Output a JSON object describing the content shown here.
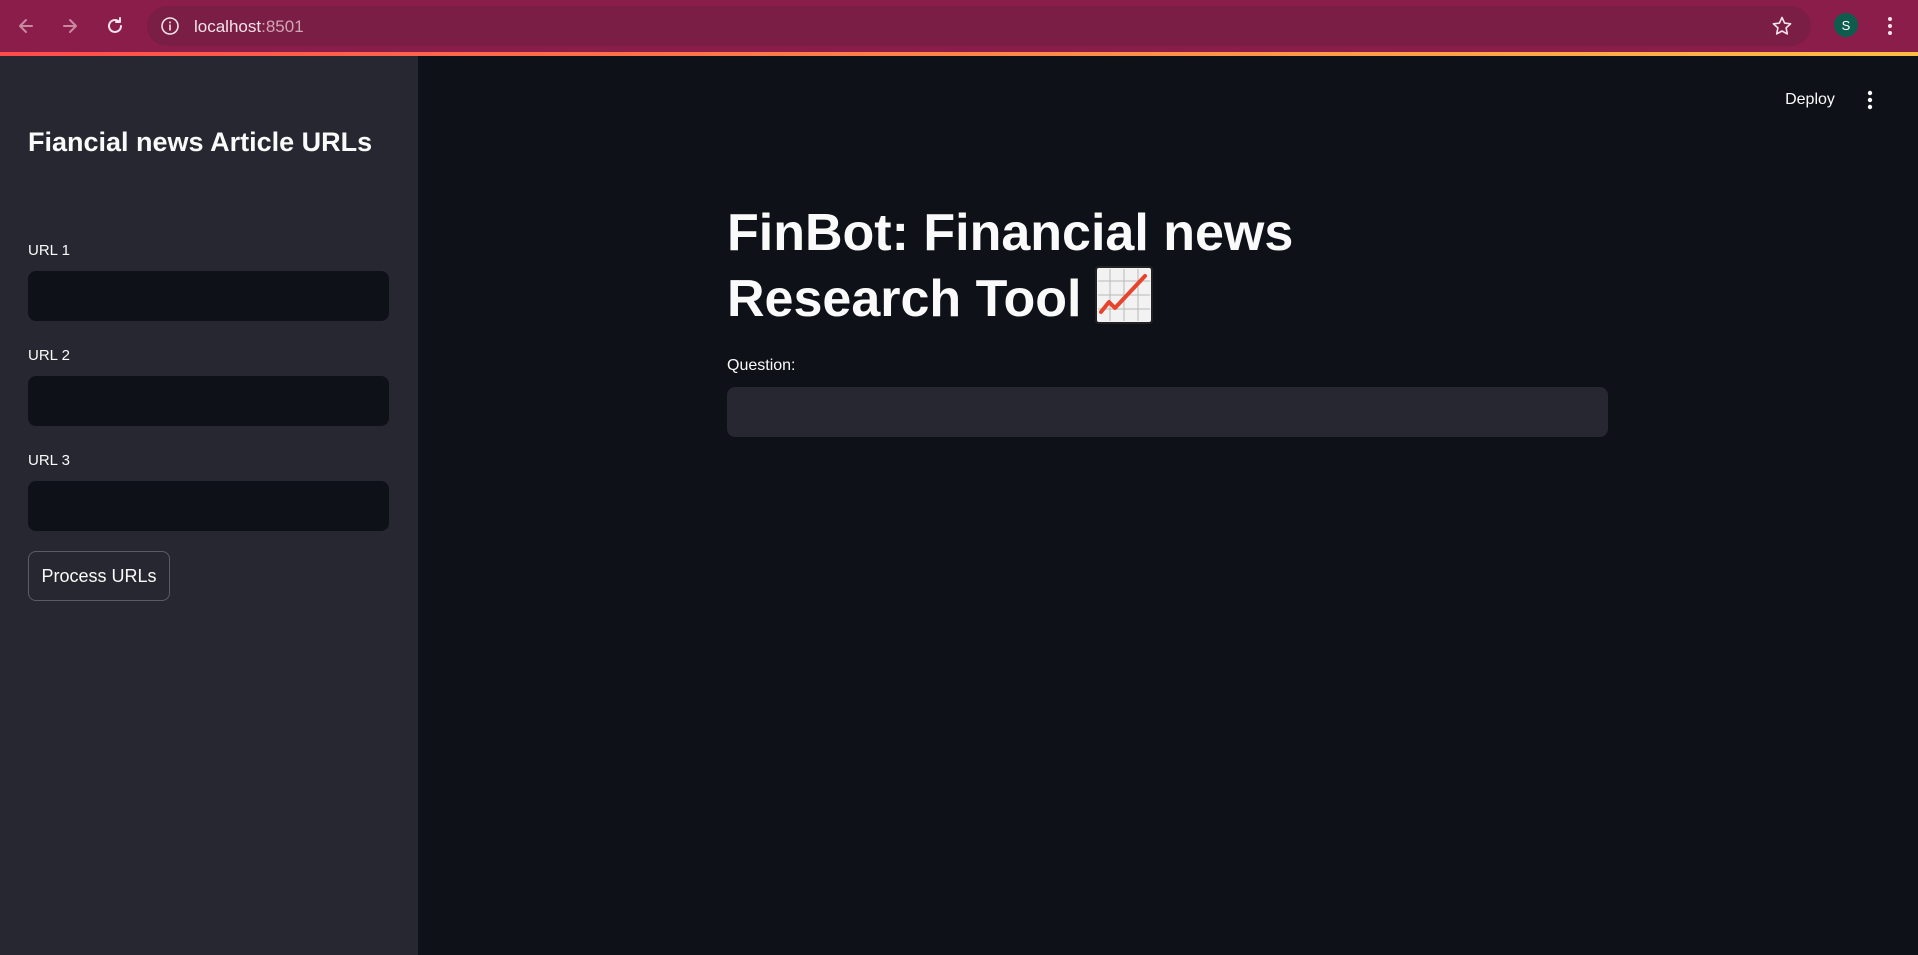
{
  "browser": {
    "url_host": "localhost",
    "url_port": ":8501",
    "profile_initial": "S",
    "theme_color": "#8b1d4a"
  },
  "sidebar": {
    "title": "Fiancial news Article URLs",
    "fields": [
      {
        "label": "URL 1",
        "value": ""
      },
      {
        "label": "URL 2",
        "value": ""
      },
      {
        "label": "URL 3",
        "value": ""
      }
    ],
    "process_button_label": "Process URLs"
  },
  "header": {
    "deploy_label": "Deploy",
    "menu_icon": "kebab-menu-icon"
  },
  "main": {
    "title": "FinBot: Financial news Research Tool",
    "title_icon": "chart-increasing-emoji",
    "question_label": "Question:",
    "question_value": ""
  },
  "colors": {
    "background": "#0e1117",
    "sidebar": "#262730",
    "text": "#fafafa",
    "accent_start": "#ff4b4b",
    "accent_end": "#ffbd45"
  }
}
